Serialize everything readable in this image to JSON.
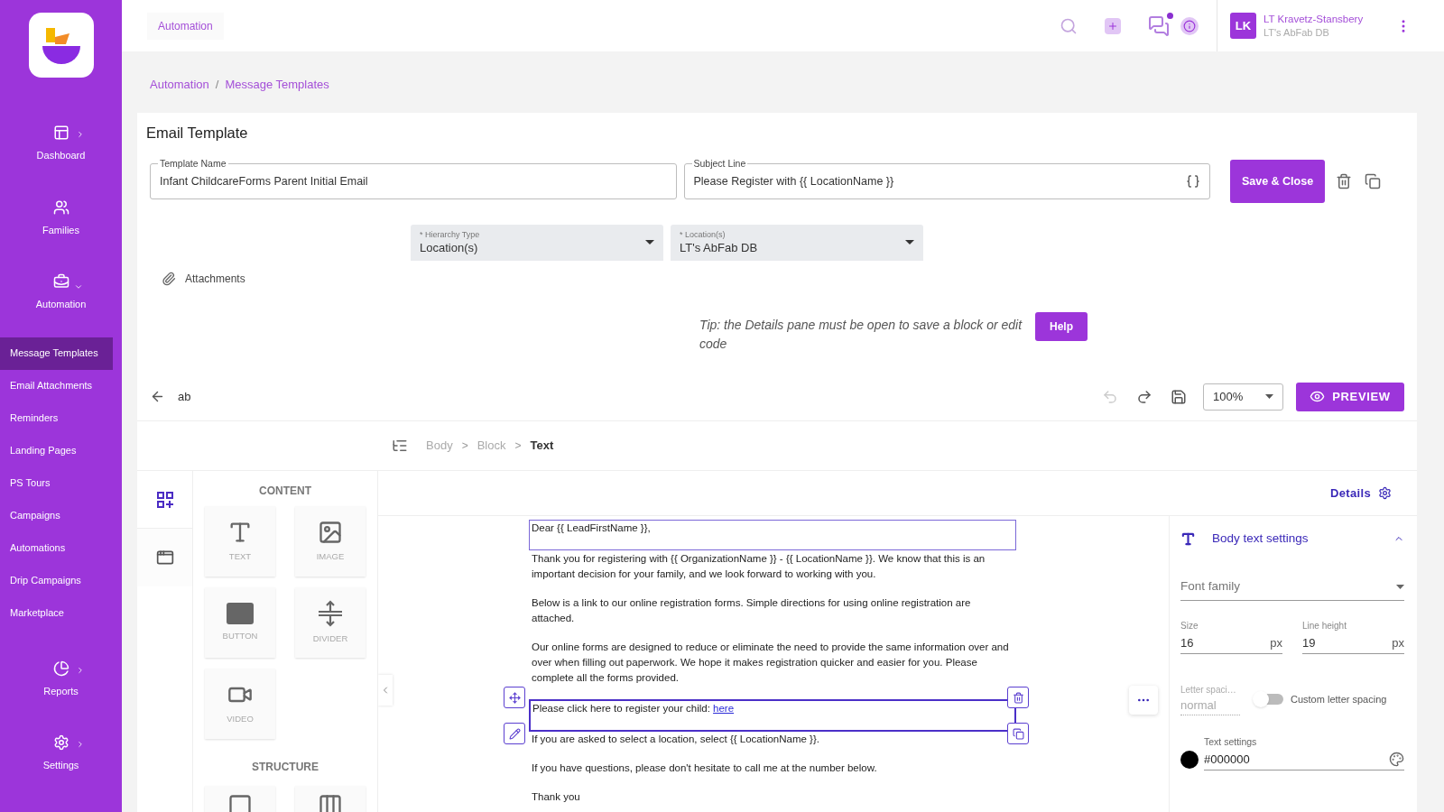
{
  "sidebar": {
    "items": [
      {
        "kind": "main",
        "label": "Dashboard",
        "selected": false,
        "expanded": false
      },
      {
        "kind": "main",
        "label": "Families",
        "selected": false
      },
      {
        "kind": "main",
        "label": "Automation",
        "selected": false,
        "expanded": true
      },
      {
        "kind": "sub",
        "label": "Message Templates",
        "selected": true
      },
      {
        "kind": "sub",
        "label": "Email Attachments",
        "selected": false
      },
      {
        "kind": "sub",
        "label": "Reminders",
        "selected": false
      },
      {
        "kind": "sub",
        "label": "Landing Pages",
        "selected": false
      },
      {
        "kind": "sub",
        "label": "PS Tours",
        "selected": false
      },
      {
        "kind": "sub",
        "label": "Campaigns",
        "selected": false
      },
      {
        "kind": "sub",
        "label": "Automations",
        "selected": false
      },
      {
        "kind": "sub",
        "label": "Drip Campaigns",
        "selected": false
      },
      {
        "kind": "sub",
        "label": "Marketplace",
        "selected": false
      },
      {
        "kind": "main",
        "label": "Reports",
        "selected": false,
        "expanded": false
      },
      {
        "kind": "main",
        "label": "Settings",
        "selected": false,
        "expanded": false
      }
    ]
  },
  "header": {
    "tab": "Automation",
    "notification_dot": true,
    "user": {
      "initials": "LK",
      "name": "LT Kravetz-Stansbery",
      "org": "LT's AbFab DB"
    }
  },
  "breadcrumb": [
    {
      "label": "Automation"
    },
    {
      "separator": "/",
      "label": "Message Templates"
    }
  ],
  "form": {
    "title": "Email Template",
    "template_name": {
      "label": "Template Name",
      "value": "Infant ChildcareForms Parent Initial Email"
    },
    "subject_line": {
      "label": "Subject Line",
      "value": "Please Register with {{ LocationName }}"
    },
    "save_button": "Save & Close",
    "hierarchy_type": {
      "label": "* Hierarchy Type",
      "value": "Location(s)"
    },
    "locations": {
      "label": "* Location(s)",
      "value": "LT's AbFab DB"
    },
    "attachments": "Attachments",
    "tip": "Tip: the Details pane must be open to save a block or edit code",
    "help_button": "Help"
  },
  "editor": {
    "name": "ab",
    "undo_disabled": true,
    "zoom": "100%",
    "preview_button": "PREVIEW",
    "path": [
      {
        "label": "Body",
        "selected": false
      },
      {
        "separator": ">",
        "label": "Block",
        "selected": false
      },
      {
        "separator": ">",
        "label": "Text",
        "selected": true
      }
    ],
    "panel_tabs": [
      {
        "kind": "blocks",
        "selected": true
      },
      {
        "kind": "body",
        "selected": false
      }
    ],
    "content_heading": "CONTENT",
    "tiles": [
      {
        "kind": "text",
        "label": "TEXT"
      },
      {
        "kind": "image",
        "label": "IMAGE"
      },
      {
        "kind": "button",
        "label": "BUTTON"
      },
      {
        "kind": "divider",
        "label": "DIVIDER"
      },
      {
        "kind": "video",
        "label": "VIDEO"
      }
    ],
    "structure_heading": "STRUCTURE",
    "structure_tiles": [
      {
        "kind": "row"
      },
      {
        "kind": "columns"
      }
    ],
    "details": "Details",
    "blocks": [
      {
        "outlined": true,
        "selected": false,
        "paragraphs": [
          {
            "text": "Dear {{ LeadFirstName }},"
          }
        ]
      },
      {
        "outlined": false,
        "selected": false,
        "paragraphs": [
          {
            "text": "Thank you for registering with {{ OrganizationName }} - {{ LocationName }}. We know that this is an important decision for your family, and we look forward to working with you."
          },
          {
            "text": "Below is a link to our online registration forms. Simple directions for using online registration are attached."
          },
          {
            "text": "Our online forms are designed to reduce or eliminate the need to provide the same information over and over when filling out paperwork. We hope it makes registration quicker and easier for you. Please complete all the forms provided."
          }
        ]
      },
      {
        "outlined": true,
        "selected": true,
        "paragraphs": [
          {
            "text": "Please click here to register your child: ",
            "link": "here"
          }
        ]
      },
      {
        "outlined": false,
        "selected": false,
        "paragraphs": [
          {
            "text": "If you are asked to select a location, select {{ LocationName }}."
          },
          {
            "text": "If you have questions, please don't hesitate to call me at the number below."
          },
          {
            "text": "Thank you"
          }
        ]
      }
    ],
    "settings": {
      "title": "Body text settings",
      "expanded": true,
      "font_family": {
        "placeholder": "Font family"
      },
      "size": {
        "label": "Size",
        "value": "16",
        "unit": "px"
      },
      "line_height": {
        "label": "Line height",
        "value": "19",
        "unit": "px"
      },
      "letter_spacing": {
        "label": "Letter spaci…",
        "placeholder": "normal"
      },
      "custom_letter_spacing": {
        "label": "Custom letter spacing",
        "on": false
      },
      "text_color": {
        "label": "Text settings",
        "value": "#000000",
        "color": "#000000"
      }
    }
  }
}
